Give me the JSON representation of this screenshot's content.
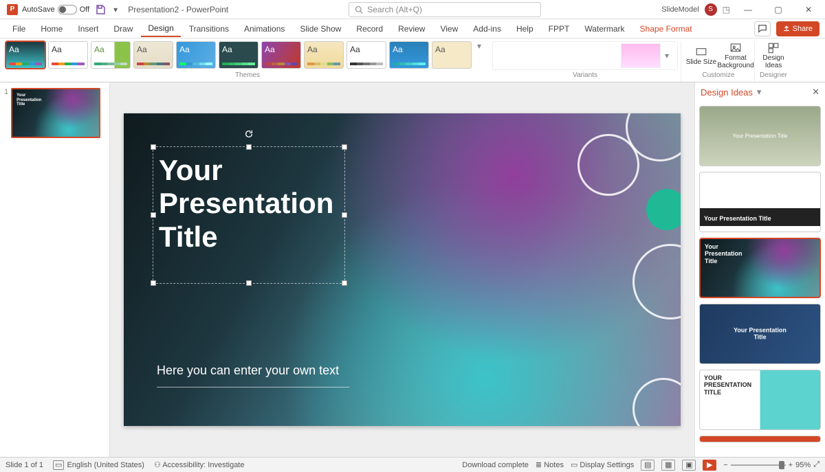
{
  "titlebar": {
    "autosave_label": "AutoSave",
    "autosave_state": "Off",
    "doc_title": "Presentation2 - PowerPoint",
    "search_placeholder": "Search (Alt+Q)",
    "account_name": "SlideModel",
    "account_initial": "S"
  },
  "tabs": {
    "items": [
      "File",
      "Home",
      "Insert",
      "Draw",
      "Design",
      "Transitions",
      "Animations",
      "Slide Show",
      "Record",
      "Review",
      "View",
      "Add-ins",
      "Help",
      "FPPT",
      "Watermark"
    ],
    "active": "Design",
    "context": "Shape Format",
    "share": "Share"
  },
  "ribbon": {
    "groups": {
      "themes": "Themes",
      "variants": "Variants",
      "customize": "Customize",
      "designer": "Designer"
    },
    "customize_buttons": {
      "slide_size": "Slide Size",
      "format_bg": "Format Background"
    },
    "designer_button": "Design Ideas"
  },
  "thumbnails": {
    "slide_number": "1"
  },
  "slide": {
    "title": "Your\nPresentation\nTitle",
    "subtitle": "Here you can enter your own text"
  },
  "design_pane": {
    "title": "Design Ideas",
    "ideas": [
      {
        "caption": "Your Presentation Title"
      },
      {
        "caption": "Your Presentation Title"
      },
      {
        "caption": "Your\nPresentation\nTitle"
      },
      {
        "caption": "Your Presentation Title"
      },
      {
        "caption": "YOUR\nPRESENTATION\nTITLE"
      }
    ]
  },
  "statusbar": {
    "slide_info": "Slide 1 of 1",
    "language": "English (United States)",
    "accessibility": "Accessibility: Investigate",
    "download": "Download complete",
    "notes": "Notes",
    "display": "Display Settings",
    "zoom_value": "95%"
  }
}
